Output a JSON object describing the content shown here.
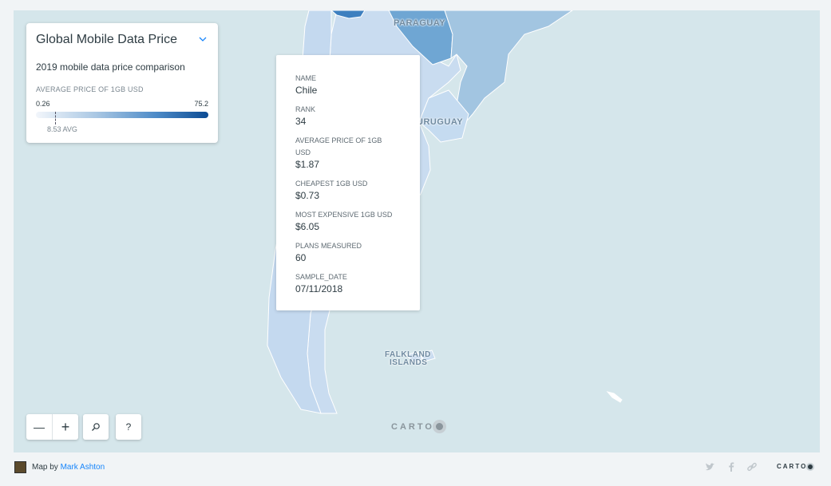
{
  "legend": {
    "title": "Global Mobile Data Price",
    "description": "2019 mobile data price comparison",
    "scale_label": "AVERAGE PRICE OF 1GB USD",
    "min": "0.26",
    "max": "75.2",
    "avg_label": "8.53 AVG",
    "avg_value": 8.53,
    "min_value": 0.26,
    "max_value": 75.2
  },
  "map": {
    "labels": {
      "paraguay": "PARAGUAY",
      "uruguay": "URUGUAY",
      "falkland_1": "FALKLAND",
      "falkland_2": "ISLANDS"
    },
    "colors": {
      "ocean": "#d5e6eb",
      "low": "#c9dcf0",
      "mid": "#a2c5e1",
      "high": "#6fa6d3"
    }
  },
  "popup": {
    "fields": [
      {
        "label": "NAME",
        "value": "Chile"
      },
      {
        "label": "RANK",
        "value": "34"
      },
      {
        "label": "AVERAGE PRICE OF 1GB USD",
        "value": "$1.87"
      },
      {
        "label": "CHEAPEST 1GB USD",
        "value": "$0.73"
      },
      {
        "label": "MOST EXPENSIVE 1GB USD",
        "value": "$6.05"
      },
      {
        "label": "PLANS MEASURED",
        "value": "60"
      },
      {
        "label": "SAMPLE_DATE",
        "value": "07/11/2018"
      }
    ]
  },
  "controls": {
    "zoom_out": "—",
    "zoom_in": "+",
    "search": "⚲",
    "help": "?"
  },
  "watermark": "CARTO",
  "footer": {
    "map_by": "Map by",
    "author": "Mark Ashton",
    "brand": "CARTO"
  }
}
